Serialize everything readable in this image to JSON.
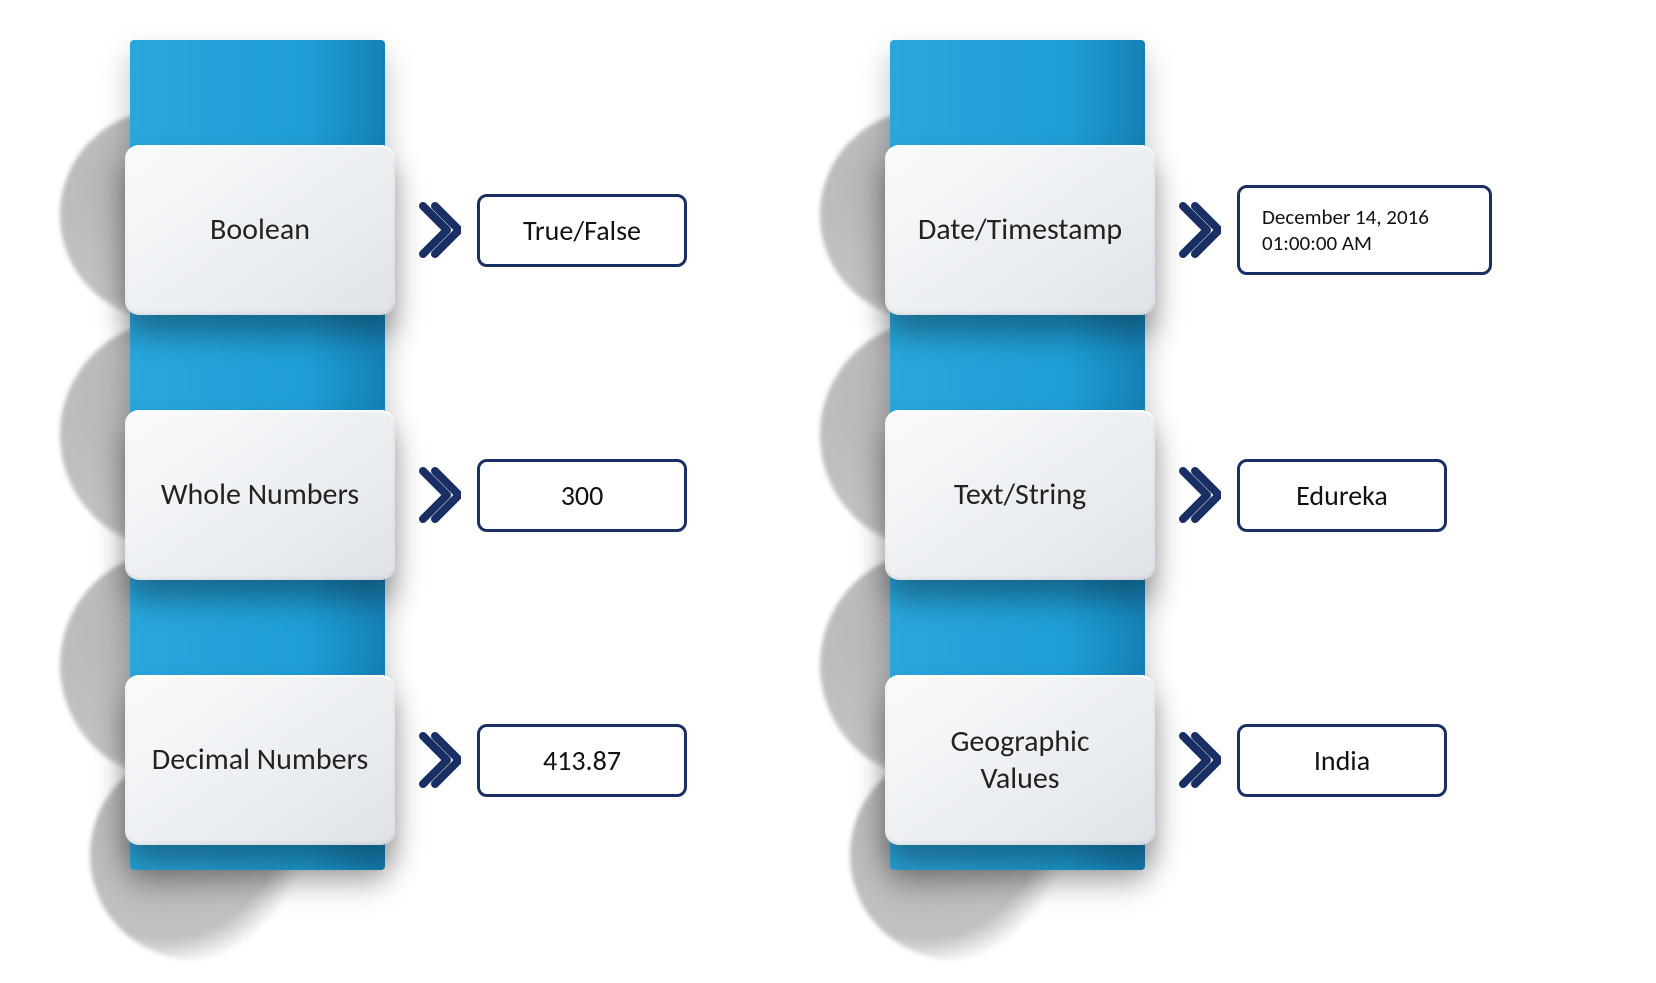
{
  "colors": {
    "pillar": "#1e9ed6",
    "border": "#1a2f63"
  },
  "columns": {
    "left": {
      "items": [
        {
          "label": "Boolean",
          "value": "True/False"
        },
        {
          "label": "Whole Numbers",
          "value": "300"
        },
        {
          "label": "Decimal Numbers",
          "value": "413.87"
        }
      ]
    },
    "right": {
      "items": [
        {
          "label": "Date/Timestamp",
          "value": "December 14, 2016 01:00:00 AM"
        },
        {
          "label": "Text/String",
          "value": "Edureka"
        },
        {
          "label": "Geographic Values",
          "value": "India"
        }
      ]
    }
  }
}
